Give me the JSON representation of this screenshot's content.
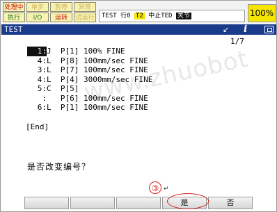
{
  "status": {
    "row1": [
      "处理中",
      "单步",
      "暂停",
      "异常"
    ],
    "row2": [
      "执行",
      "I/O",
      "运转",
      "试运行"
    ],
    "program": "TEST",
    "line_label": "行0",
    "t_mode": "T2",
    "stop_label": "中止TED",
    "joint": "关节",
    "override": "100%"
  },
  "titlebar": {
    "title": "TEST",
    "arrow": "↙",
    "info_icon": "i"
  },
  "page_counter": "1/7",
  "program_lines": [
    {
      "num": "1:",
      "cmd": "J  P[1] 100% FINE"
    },
    {
      "num": "4:",
      "cmd": "L  P[8] 100mm/sec FINE"
    },
    {
      "num": "3:",
      "cmd": "L  P[7] 100mm/sec FINE"
    },
    {
      "num": "4:",
      "cmd": "L  P[4] 3000mm/sec FINE"
    },
    {
      "num": "5:",
      "cmd": "C  P[5]"
    },
    {
      "num": ":",
      "cmd": "   P[6] 100mm/sec FINE"
    },
    {
      "num": "6:",
      "cmd": "L  P[1] 100mm/sec FINE"
    }
  ],
  "end_label": "[End]",
  "prompt": "是否改变编号？",
  "watermark": "www.zhuobot",
  "annotation": {
    "step": "③"
  },
  "fkeys": [
    "",
    "",
    "",
    "是",
    "否"
  ]
}
